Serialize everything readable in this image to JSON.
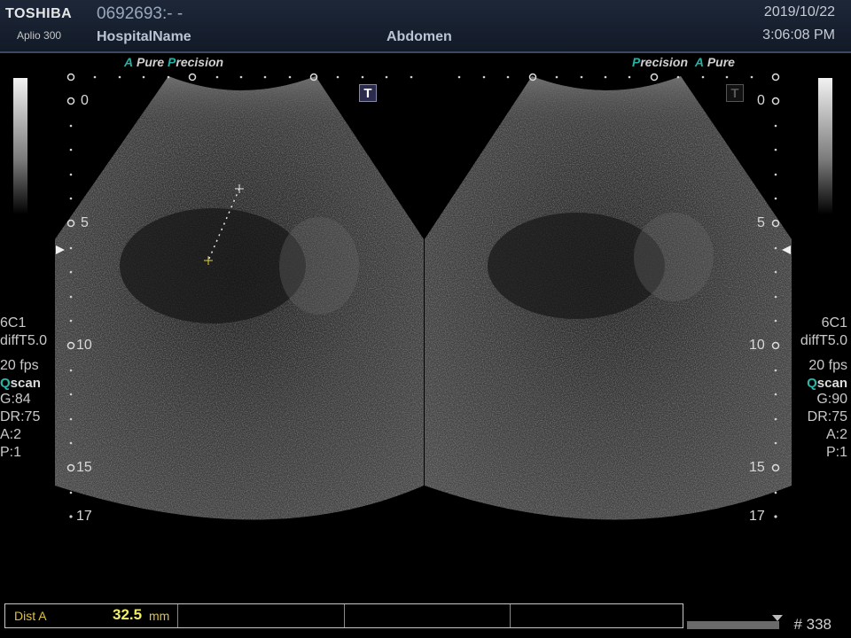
{
  "header": {
    "brand": "TOSHIBA",
    "model": "Aplio 300",
    "patient_id": "0692693:- -",
    "hospital": "HospitalName",
    "exam": "Abdomen",
    "date": "2019/10/22",
    "time": "3:06:08 PM"
  },
  "modes": {
    "left": {
      "a": "A",
      "pure": "Pure",
      "p": "P",
      "precision": "recision"
    },
    "right": {
      "p": "P",
      "precision": "recision",
      "a": "A",
      "pure": "Pure"
    }
  },
  "depth_labels": [
    "0",
    "5",
    "10",
    "15",
    "17"
  ],
  "left_params": {
    "probe": "6C1",
    "filter": "diffT5.0",
    "fps": "20 fps",
    "qscan_q": "Q",
    "qscan_rest": "scan",
    "gain": "G:84",
    "dr": "DR:75",
    "a": "A:2",
    "p": "P:1"
  },
  "right_params": {
    "probe": "6C1",
    "filter": "diffT5.0",
    "fps": "20 fps",
    "qscan_q": "Q",
    "qscan_rest": "scan",
    "gain": "G:90",
    "dr": "DR:75",
    "a": "A:2",
    "p": "P:1"
  },
  "icons": {
    "t_left": "T",
    "t_right": "T",
    "caliper_cross": "plus-icon",
    "focus_marker": "triangle-icon"
  },
  "measurement": {
    "label": "Dist A",
    "value": "32.5",
    "unit": "mm"
  },
  "frame": "# 338",
  "colors": {
    "header_bg": "#1d2738",
    "accent_teal": "#28b0a5",
    "measure_yellow": "#f2f060",
    "caliper_yellow": "#d8d04a"
  }
}
